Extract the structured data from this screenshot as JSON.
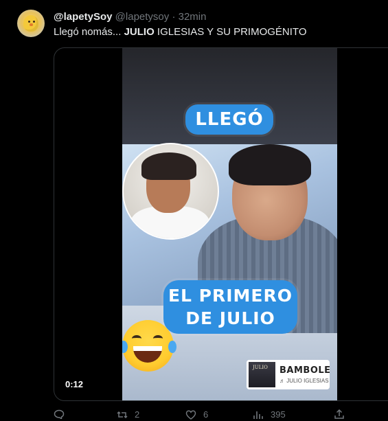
{
  "tweet": {
    "display_name": "@lapetySoy",
    "handle": "@lapetysoy",
    "separator": "·",
    "time": "32min",
    "text_prefix": "Llegó nomás... ",
    "text_bold": "JULIO",
    "text_suffix": " IGLESIAS Y SU PRIMOGÉNITO"
  },
  "video": {
    "caption_top": "LLEGÓ",
    "caption_bottom_line1": "EL PRIMERO",
    "caption_bottom_line2": "DE JULIO",
    "music_cover_title": "JULIO",
    "music_song": "BAMBOLEO",
    "music_artist": "♬ JULIO IGLESIAS",
    "timer": "0:12"
  },
  "actions": {
    "reply_count": "",
    "retweet_count": "2",
    "like_count": "6",
    "views_count": "395"
  },
  "colors": {
    "background": "#000000",
    "text": "#e7e9ea",
    "muted": "#71767b",
    "caption_blue": "#2f8fe0"
  }
}
